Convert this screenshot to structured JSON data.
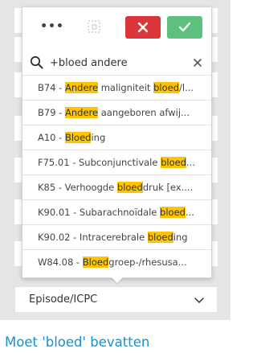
{
  "search": {
    "value": "+bloed andere"
  },
  "results": [
    {
      "parts": [
        {
          "t": "B74 - ",
          "h": false
        },
        {
          "t": "Andere",
          "h": true
        },
        {
          "t": " maligniteit ",
          "h": false
        },
        {
          "t": "bloed",
          "h": true
        },
        {
          "t": "/l...",
          "h": false
        }
      ]
    },
    {
      "parts": [
        {
          "t": "B79 - ",
          "h": false
        },
        {
          "t": "Andere",
          "h": true
        },
        {
          "t": " aangeboren afwij...",
          "h": false
        }
      ]
    },
    {
      "parts": [
        {
          "t": "A10 - ",
          "h": false
        },
        {
          "t": "Bloed",
          "h": true
        },
        {
          "t": "ing",
          "h": false
        }
      ]
    },
    {
      "parts": [
        {
          "t": "F75.01 - Subconjunctivale ",
          "h": false
        },
        {
          "t": "bloed",
          "h": true
        },
        {
          "t": "...",
          "h": false
        }
      ]
    },
    {
      "parts": [
        {
          "t": "K85 - Verhoogde ",
          "h": false
        },
        {
          "t": "bloed",
          "h": true
        },
        {
          "t": "druk [ex....",
          "h": false
        }
      ]
    },
    {
      "parts": [
        {
          "t": "K90.01 - Subarachnoïdale ",
          "h": false
        },
        {
          "t": "bloed",
          "h": true
        },
        {
          "t": "...",
          "h": false
        }
      ]
    },
    {
      "parts": [
        {
          "t": "K90.02 - Intracerebrale ",
          "h": false
        },
        {
          "t": "bloed",
          "h": true
        },
        {
          "t": "ing",
          "h": false
        }
      ]
    },
    {
      "parts": [
        {
          "t": "W84.08 - ",
          "h": false
        },
        {
          "t": "Bloed",
          "h": true
        },
        {
          "t": "groep-/rhesusa...",
          "h": false
        }
      ]
    }
  ],
  "toolbar": {
    "more_label": "•••"
  },
  "episode_select": {
    "label": "Episode/ICPC"
  },
  "hint": "Moet 'bloed' bevatten",
  "icons": {
    "more": "more-icon",
    "disabled_action": "dashed-square-icon",
    "cancel": "x-icon",
    "confirm": "check-icon",
    "search": "search-icon",
    "clear": "close-icon",
    "dropdown": "chevron-down-icon"
  },
  "colors": {
    "cancel": "#d9353a",
    "confirm": "#5dbf80",
    "highlight": "#ffc400",
    "hint_text": "#1e8ec7",
    "panel_bg": "#e5e5e5"
  }
}
